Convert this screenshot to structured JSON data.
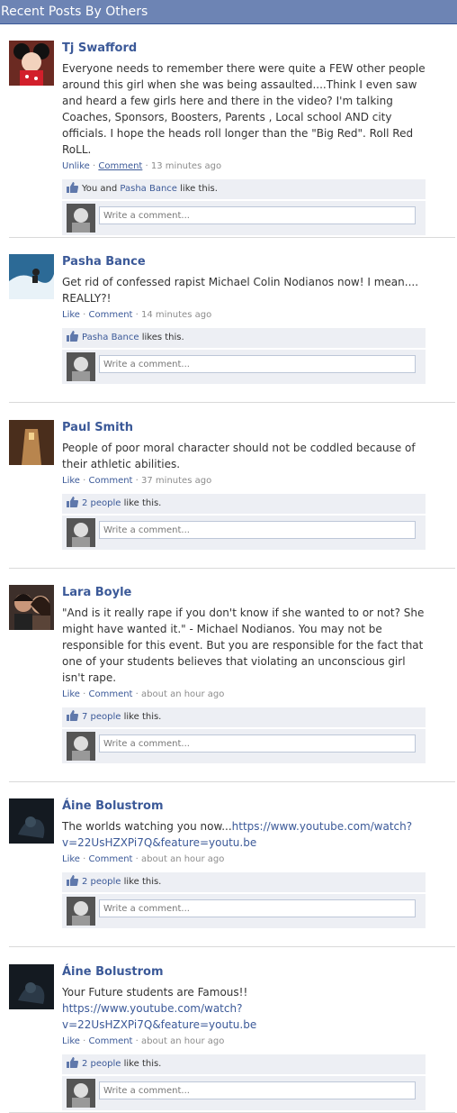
{
  "header": {
    "title": "Recent Posts By Others"
  },
  "posts": [
    {
      "author": "Tj Swafford",
      "text": "Everyone needs to remember there were quite a FEW other people around this girl when she was being assaulted....Think I even saw and heard a few girls here and there in the video? I'm talking Coaches, Sponsors, Boosters, Parents , Local school AND city officials. I hope the heads roll longer than the \"Big Red\". Roll Red RoLL.",
      "like_action": "Unlike",
      "comment_action": "Comment",
      "time": "13 minutes ago",
      "likes_prefix": "You and ",
      "likes_link": "Pasha Bance",
      "likes_suffix": " like this.",
      "comment_placeholder": "Write a comment..."
    },
    {
      "author": "Pasha Bance",
      "text": "Get rid of confessed rapist Michael Colin Nodianos now! I mean.... REALLY?!",
      "like_action": "Like",
      "comment_action": "Comment",
      "time": "14 minutes ago",
      "likes_prefix": "",
      "likes_link": "Pasha Bance",
      "likes_suffix": " likes this.",
      "comment_placeholder": "Write a comment..."
    },
    {
      "author": "Paul Smith",
      "text": "People of poor moral character should not be coddled because of their athletic abilities.",
      "like_action": "Like",
      "comment_action": "Comment",
      "time": "37 minutes ago",
      "likes_prefix": "",
      "likes_link": "2 people",
      "likes_suffix": " like this.",
      "comment_placeholder": "Write a comment..."
    },
    {
      "author": "Lara Boyle",
      "text": "\"And is it really rape if you don't know if she wanted to or not? She might have wanted it.\" - Michael Nodianos. You may not be responsible for this event. But you are responsible for the fact that one of your students believes that violating an unconscious girl isn't rape.",
      "like_action": "Like",
      "comment_action": "Comment",
      "time": "about an hour ago",
      "likes_prefix": "",
      "likes_link": "7 people",
      "likes_suffix": " like this.",
      "comment_placeholder": "Write a comment..."
    },
    {
      "author": "Áine Bolustrom",
      "text_plain": "The worlds watching you now...",
      "text_link": "https://www.youtube.com/watch?v=22UsHZXPi7Q&feature=youtu.be",
      "like_action": "Like",
      "comment_action": "Comment",
      "time": "about an hour ago",
      "likes_prefix": "",
      "likes_link": "2 people",
      "likes_suffix": " like this.",
      "comment_placeholder": "Write a comment..."
    },
    {
      "author": "Áine Bolustrom",
      "text_plain": "Your Future students are Famous!! ",
      "text_link": "https://www.youtube.com/watch?v=22UsHZXPi7Q&feature=youtu.be",
      "like_action": "Like",
      "comment_action": "Comment",
      "time": "about an hour ago",
      "likes_prefix": "",
      "likes_link": "2 people",
      "likes_suffix": " like this.",
      "comment_placeholder": "Write a comment..."
    }
  ],
  "meta_separator": " · "
}
